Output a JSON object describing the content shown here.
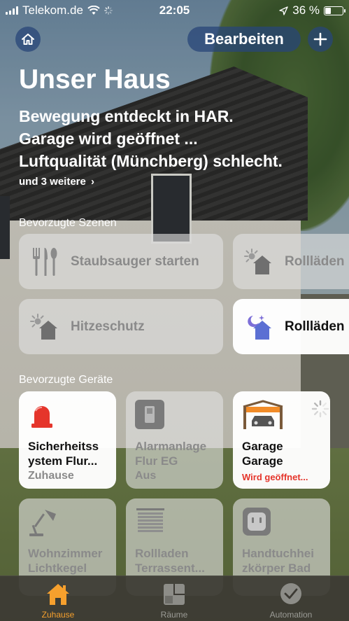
{
  "status_bar": {
    "carrier": "Telekom.de",
    "time": "22:05",
    "battery_percent": "36 %",
    "battery_level": 0.36
  },
  "header": {
    "edit_label": "Bearbeiten",
    "title": "Unser Haus",
    "alerts": [
      "Bewegung entdeckt in HAR.",
      "Garage wird geöffnet ...",
      "Luftqualität (Münchberg) schlecht."
    ],
    "more_label": "und 3 weitere"
  },
  "scenes": {
    "section_label": "Bevorzugte Szenen",
    "items": [
      {
        "label": "Staubsauger starten",
        "icon": "cutlery-icon",
        "active": false
      },
      {
        "label": "Rollläden",
        "icon": "sun-house-icon",
        "active": false
      },
      {
        "label": "Hitzeschutz",
        "icon": "sun-house-icon",
        "active": false
      },
      {
        "label": "Rollläden n",
        "icon": "moon-house-icon",
        "active": true
      }
    ]
  },
  "devices": {
    "section_label": "Bevorzugte Geräte",
    "items": [
      {
        "name": "Sicherheitss ystem Flur...",
        "state": "Zuhause",
        "icon": "siren-icon",
        "active": true
      },
      {
        "name": "Alarmanlage Flur EG",
        "state": "Aus",
        "icon": "alarm-panel-icon",
        "active": false
      },
      {
        "name": "Garage Garage",
        "state": "Wird geöffnet...",
        "icon": "garage-icon",
        "active": true
      },
      {
        "name": "Wohnzimmer Lichtkegel",
        "state": "",
        "icon": "desk-lamp-icon",
        "active": false
      },
      {
        "name": "Rollladen Terrassent...",
        "state": "",
        "icon": "blinds-icon",
        "active": false
      },
      {
        "name": "Handtuchhei zkörper Bad",
        "state": "",
        "icon": "outlet-icon",
        "active": false
      }
    ]
  },
  "tabbar": {
    "tabs": [
      {
        "label": "Zuhause",
        "icon": "house-icon",
        "active": true
      },
      {
        "label": "Räume",
        "icon": "rooms-icon",
        "active": false
      },
      {
        "label": "Automation",
        "icon": "automation-icon",
        "active": false
      }
    ]
  },
  "colors": {
    "accent": "#f6a02d",
    "alert": "#e5352b",
    "button_bg": "#284678"
  }
}
